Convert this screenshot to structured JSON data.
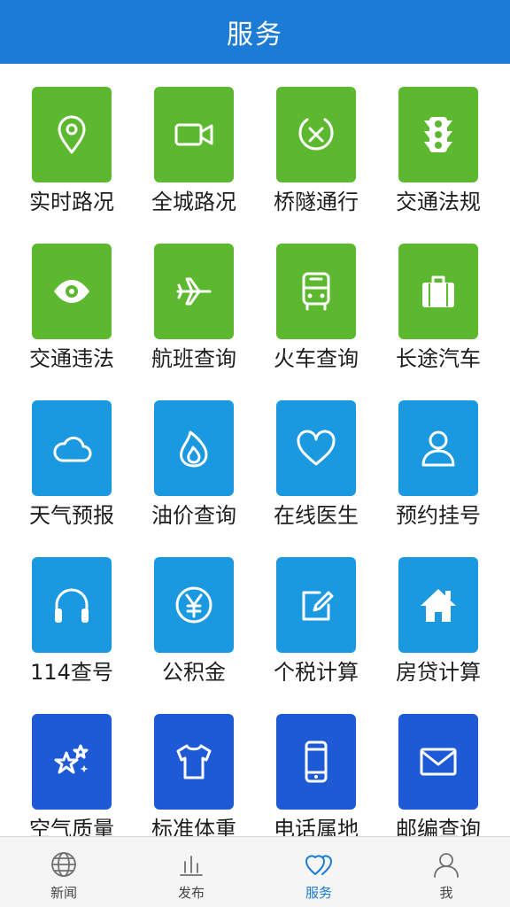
{
  "header": {
    "title": "服务"
  },
  "colors": {
    "green": "#5cb82e",
    "lightblue": "#1a98e0",
    "darkblue": "#1e5ad6",
    "header": "#1c7bd4",
    "active": "#1c7bd4"
  },
  "services": [
    {
      "label": "实时路况",
      "icon": "location-pin-icon",
      "color": "green"
    },
    {
      "label": "全城路况",
      "icon": "video-camera-icon",
      "color": "green"
    },
    {
      "label": "桥隧通行",
      "icon": "circle-x-icon",
      "color": "green"
    },
    {
      "label": "交通法规",
      "icon": "traffic-light-icon",
      "color": "green"
    },
    {
      "label": "交通违法",
      "icon": "eye-icon",
      "color": "green"
    },
    {
      "label": "航班查询",
      "icon": "airplane-icon",
      "color": "green"
    },
    {
      "label": "火车查询",
      "icon": "train-icon",
      "color": "green"
    },
    {
      "label": "长途汽车",
      "icon": "luggage-icon",
      "color": "green"
    },
    {
      "label": "天气预报",
      "icon": "cloud-icon",
      "color": "lightblue"
    },
    {
      "label": "油价查询",
      "icon": "flame-icon",
      "color": "lightblue"
    },
    {
      "label": "在线医生",
      "icon": "heart-icon",
      "color": "lightblue"
    },
    {
      "label": "预约挂号",
      "icon": "person-icon",
      "color": "lightblue"
    },
    {
      "label": "114查号",
      "icon": "headphones-icon",
      "color": "lightblue"
    },
    {
      "label": "公积金",
      "icon": "yuan-icon",
      "color": "lightblue"
    },
    {
      "label": "个税计算",
      "icon": "edit-icon",
      "color": "lightblue"
    },
    {
      "label": "房贷计算",
      "icon": "house-icon",
      "color": "lightblue"
    },
    {
      "label": "空气质量",
      "icon": "stars-icon",
      "color": "darkblue"
    },
    {
      "label": "标准体重",
      "icon": "tshirt-icon",
      "color": "darkblue"
    },
    {
      "label": "电话属地",
      "icon": "phone-icon",
      "color": "darkblue"
    },
    {
      "label": "邮编查询",
      "icon": "mail-icon",
      "color": "darkblue"
    }
  ],
  "tabs": [
    {
      "label": "新闻",
      "icon": "globe-icon",
      "active": false
    },
    {
      "label": "发布",
      "icon": "bar-chart-icon",
      "active": false
    },
    {
      "label": "服务",
      "icon": "double-heart-icon",
      "active": true
    },
    {
      "label": "我",
      "icon": "user-icon",
      "active": false
    }
  ]
}
